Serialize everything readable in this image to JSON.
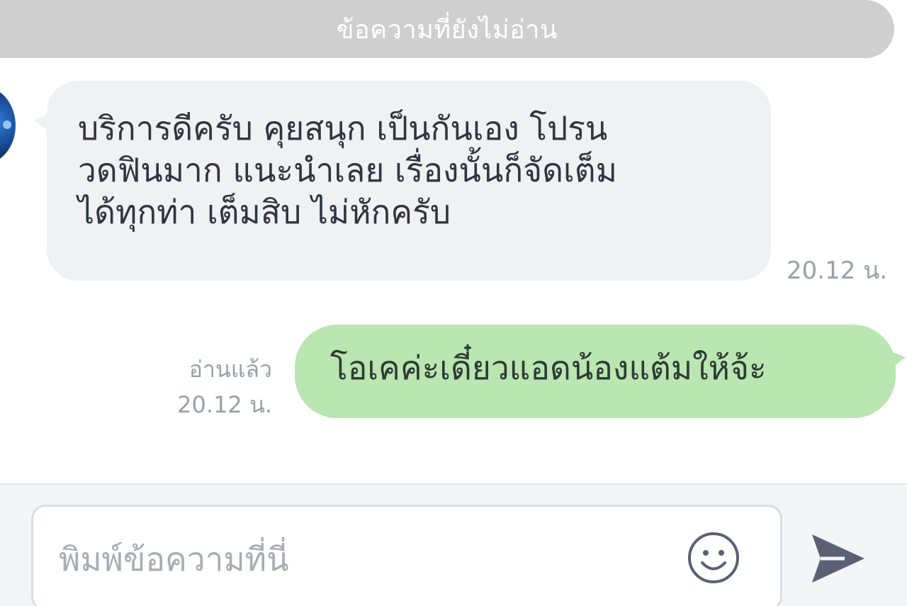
{
  "divider": {
    "unread_label": "ข้อความที่ยังไม่อ่าน"
  },
  "messages": [
    {
      "direction": "incoming",
      "text": "บริการดีครับ คุยสนุก เป็นกันเอง โปรน\nวดฟินมาก แนะนำเลย เรื่องนั้นก็จัดเต็ม\nได้ทุกท่า เต็มสิบ ไม่หักครับ",
      "time": "20.12 น."
    },
    {
      "direction": "outgoing",
      "text": "โอเคค่ะเดี๋ยวแอดน้องแต้มให้จ้ะ",
      "read_label": "อ่านแล้ว",
      "time": "20.12 น."
    }
  ],
  "composer": {
    "placeholder": "พิมพ์ข้อความที่นี่",
    "value": ""
  },
  "icons": {
    "emoji": "smiley-icon",
    "send": "send-icon",
    "avatar": "avatar-image"
  },
  "colors": {
    "incoming_bubble": "#f0f1f3",
    "outgoing_bubble": "#b9e6b1",
    "divider": "#cfcfcf",
    "icon": "#5b6074"
  }
}
